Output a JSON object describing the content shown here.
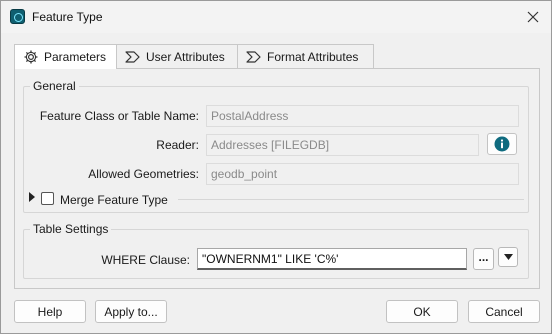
{
  "window": {
    "title": "Feature Type"
  },
  "tabs": [
    {
      "label": "Parameters",
      "icon": "gear-icon"
    },
    {
      "label": "User Attributes",
      "icon": "attribute-icon"
    },
    {
      "label": "Format Attributes",
      "icon": "attribute-icon"
    }
  ],
  "general": {
    "title": "General",
    "feature_class_label": "Feature Class or Table Name:",
    "feature_class_value": "PostalAddress",
    "reader_label": "Reader:",
    "reader_value": "Addresses [FILEGDB]",
    "allowed_geometries_label": "Allowed Geometries:",
    "allowed_geometries_value": "geodb_point",
    "merge_feature_type_label": "Merge Feature Type",
    "merge_feature_type_checked": false
  },
  "table_settings": {
    "title": "Table Settings",
    "where_label": "WHERE Clause:",
    "where_value": "\"OWNERNM1\" LIKE 'C%'",
    "ellipsis_label": "..."
  },
  "buttons": {
    "help": "Help",
    "apply_to": "Apply to...",
    "ok": "OK",
    "cancel": "Cancel"
  },
  "colors": {
    "info_icon": "#0f6b7f",
    "app_icon": "#0f5f70"
  }
}
